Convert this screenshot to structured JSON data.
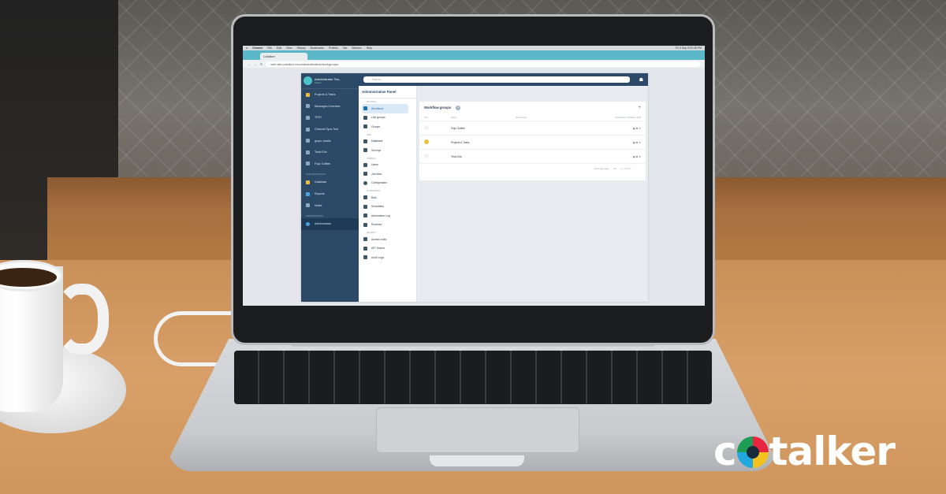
{
  "browser": {
    "app_name": "Chrome",
    "menu": [
      "File",
      "Edit",
      "View",
      "History",
      "Bookmarks",
      "Profiles",
      "Tab",
      "Window",
      "Help"
    ],
    "clock": "Fri 3 Sep 5:02:28 PM",
    "tab_title": "Cotalker",
    "url": "web.dev.cotalker.com/administrative/workgroups"
  },
  "user": {
    "name": "Administrator Tes..",
    "status": "Online"
  },
  "search": {
    "placeholder": "Search"
  },
  "sidebar": {
    "items": [
      {
        "label": "Projects & Tasks",
        "icon": "bell-icon"
      },
      {
        "label": "Messages Overview",
        "icon": "grid-icon"
      },
      {
        "label": "TEST",
        "icon": "grid-icon"
      },
      {
        "label": "Channel Sync Test",
        "icon": "grid-icon"
      },
      {
        "label": "grupo chartis",
        "icon": "grid-icon"
      },
      {
        "label": "Tests Edu",
        "icon": "grid-icon"
      },
      {
        "label": "Flujo Gotlieb",
        "icon": "grid-icon"
      }
    ],
    "section_info": "DATA INFORMATION",
    "info_items": [
      {
        "label": "Database",
        "icon": "database-icon"
      },
      {
        "label": "Reports",
        "icon": "reports-icon"
      },
      {
        "label": "Notes",
        "icon": "notes-icon"
      }
    ],
    "section_admin": "ADMINISTRATION",
    "admin_item": "Administrator"
  },
  "admin_panel": {
    "title": "Administrative Panel",
    "sections": [
      {
        "name": "Settings",
        "items": [
          "Workflows",
          "Link groups",
          "Groups"
        ]
      },
      {
        "name": "Data",
        "items": [
          "Database",
          "Surveys"
        ]
      },
      {
        "name": "Company",
        "items": [
          "Users",
          "Job titles",
          "Configuration"
        ]
      },
      {
        "name": "Automations",
        "items": [
          "Bots",
          "Schedules",
          "Automation Log",
          "Routines"
        ]
      },
      {
        "name": "Security",
        "items": [
          "Access roles",
          "API Tokens",
          "Audit Logs"
        ]
      }
    ]
  },
  "workflow_groups": {
    "title": "Workflow groups",
    "columns": [
      "Icon",
      "Name",
      "Description",
      "Workflows / Defaults / Edit"
    ],
    "rows": [
      {
        "name": "Flujo Gotlieb",
        "icon": "blank"
      },
      {
        "name": "Projects & Tasks",
        "icon": "star"
      },
      {
        "name": "Tests Edu",
        "icon": "blank"
      }
    ],
    "pagination": {
      "label": "Items per page",
      "value": "10",
      "range": "1 – 3 of 3"
    }
  },
  "brand": {
    "text_pre": "c",
    "text_post": "talker"
  }
}
